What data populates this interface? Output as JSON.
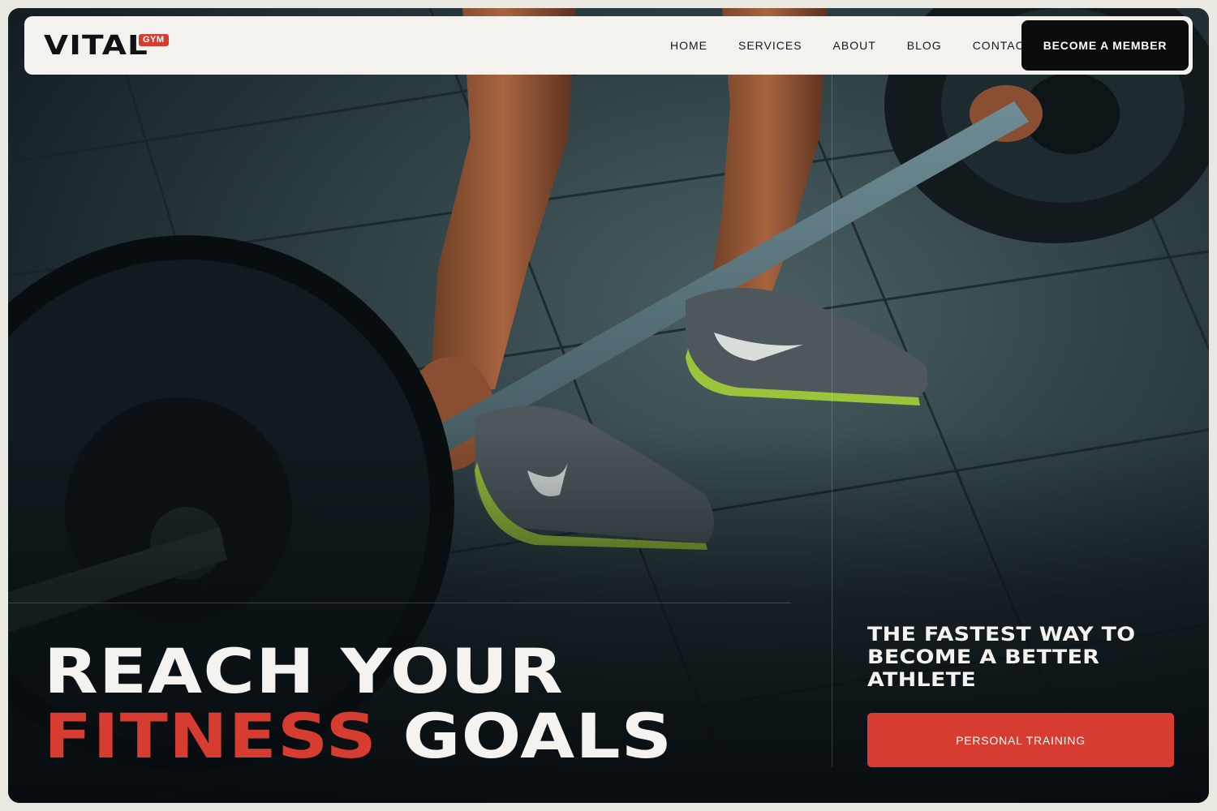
{
  "brand": {
    "name": "VITAL",
    "badge": "GYM",
    "accent_color": "#d63c30",
    "dark_color": "#0a0b0d"
  },
  "nav": {
    "items": [
      {
        "label": "HOME"
      },
      {
        "label": "SERVICES"
      },
      {
        "label": "ABOUT"
      },
      {
        "label": "BLOG"
      },
      {
        "label": "CONTACT"
      }
    ],
    "cta_label": "BECOME A MEMBER"
  },
  "hero": {
    "image_subject": "deadlift-barbell-photo",
    "headline_line1": "REACH YOUR",
    "headline_accent": "FITNESS",
    "headline_rest": "GOALS",
    "subheading": "THE FASTEST WAY TO BECOME A BETTER ATHLETE",
    "cta_label": "PERSONAL TRAINING"
  }
}
